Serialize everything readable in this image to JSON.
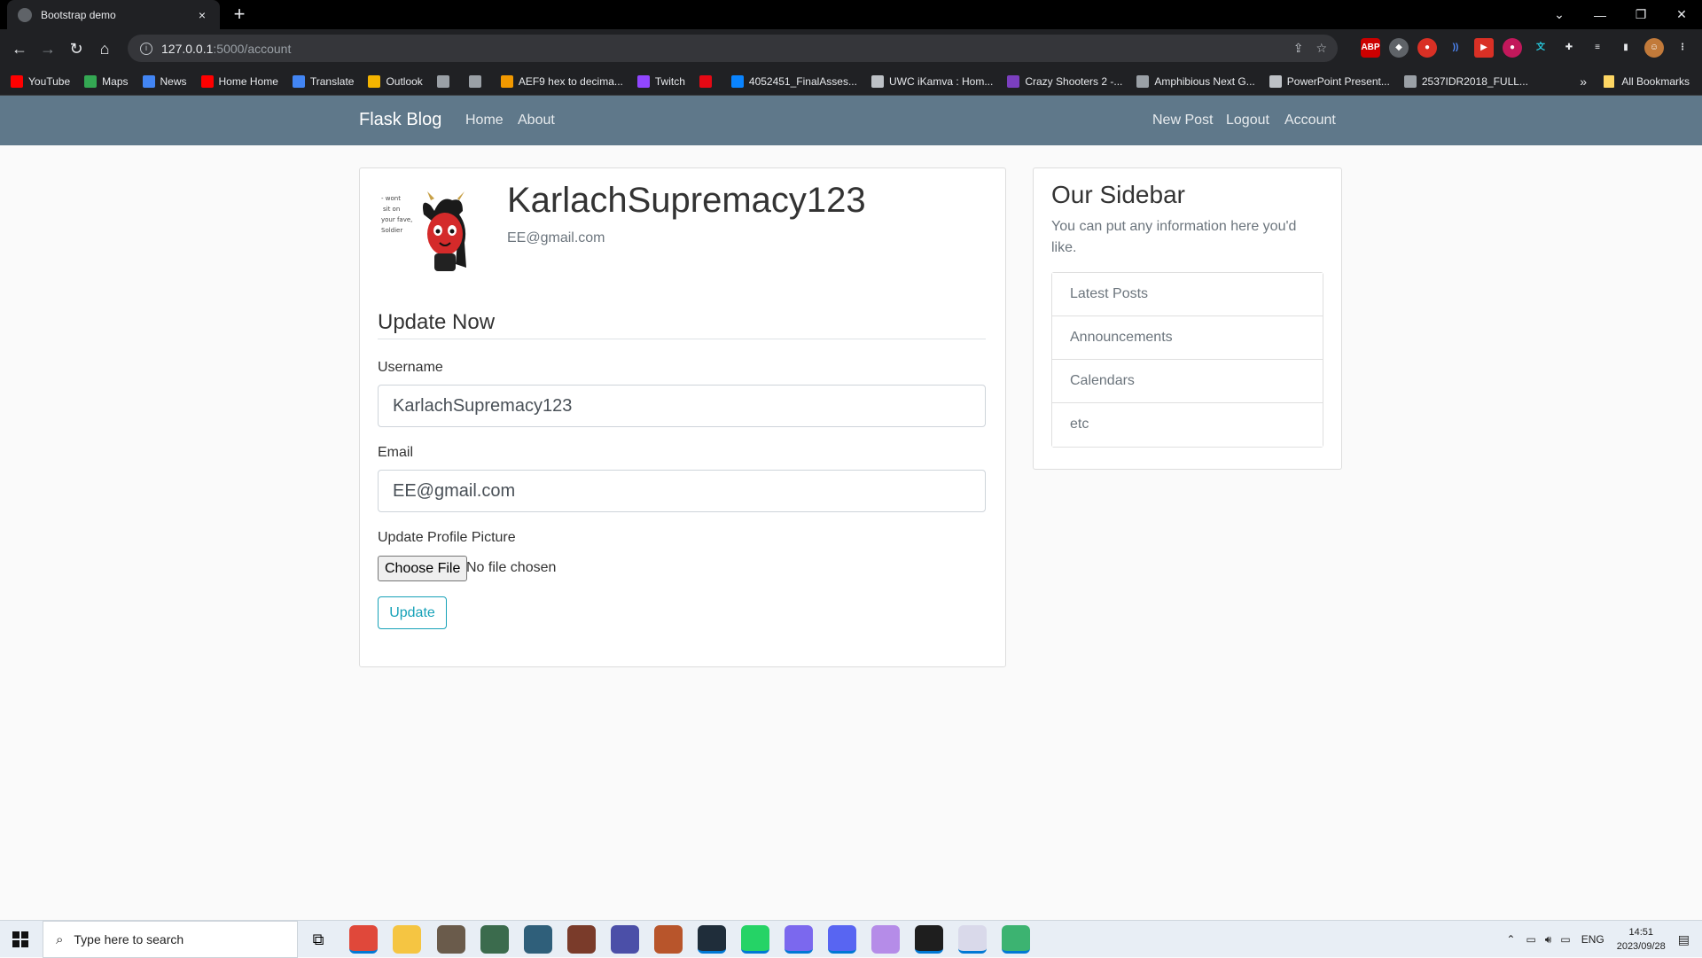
{
  "browser": {
    "tab_title": "Bootstrap demo",
    "tab_close": "×",
    "new_tab": "+",
    "url_host": "127.0.0.1",
    "url_path": ":5000/account",
    "bookmarks": [
      {
        "label": "YouTube",
        "icon": "youtube-icon",
        "color": "#ff0000"
      },
      {
        "label": "Maps",
        "icon": "maps-icon",
        "color": "#34a853"
      },
      {
        "label": "News",
        "icon": "news-icon",
        "color": "#4285f4"
      },
      {
        "label": "Home Home",
        "icon": "youtube-icon",
        "color": "#ff0000"
      },
      {
        "label": "Translate",
        "icon": "translate-icon",
        "color": "#4285f4"
      },
      {
        "label": "Outlook",
        "icon": "outlook-icon",
        "color": "#f4b400"
      },
      {
        "label": "",
        "icon": "globe-icon",
        "color": "#9aa0a6"
      },
      {
        "label": "",
        "icon": "globe-icon",
        "color": "#9aa0a6"
      },
      {
        "label": "AEF9 hex to decima...",
        "icon": "r-icon",
        "color": "#f29900"
      },
      {
        "label": "Twitch",
        "icon": "twitch-icon",
        "color": "#9146ff"
      },
      {
        "label": "",
        "icon": "netflix-icon",
        "color": "#e50914"
      },
      {
        "label": "4052451_FinalAsses...",
        "icon": "onedrive-icon",
        "color": "#0a84ff"
      },
      {
        "label": "UWC iKamva : Hom...",
        "icon": "uwc-icon",
        "color": "#bdc1c6"
      },
      {
        "label": "Crazy Shooters 2 -...",
        "icon": "crazy-icon",
        "color": "#7b3fbf"
      },
      {
        "label": "Amphibious Next G...",
        "icon": "globe-icon",
        "color": "#9aa0a6"
      },
      {
        "label": "PowerPoint Present...",
        "icon": "uwc-icon",
        "color": "#bdc1c6"
      },
      {
        "label": "2537IDR2018_FULL...",
        "icon": "globe-icon",
        "color": "#9aa0a6"
      }
    ],
    "bookmarks_more": "»",
    "all_bookmarks": "All Bookmarks"
  },
  "site": {
    "brand": "Flask Blog",
    "nav_left": [
      "Home",
      "About"
    ],
    "nav_right": [
      "New Post",
      "Logout",
      "Account"
    ],
    "navbar_color": "#5f788a"
  },
  "account": {
    "username": "KarlachSupremacy123",
    "email": "EE@gmail.com",
    "avatar_caption": "- wont\nsit on\nyour fave,\nSoldier",
    "legend": "Update Now",
    "username_label": "Username",
    "username_value": "KarlachSupremacy123",
    "email_label": "Email",
    "email_value": "EE@gmail.com",
    "picture_label": "Update Profile Picture",
    "choose_file": "Choose File",
    "file_status": "No file chosen",
    "submit": "Update",
    "accent": "#17a2b8"
  },
  "sidebar": {
    "title": "Our Sidebar",
    "text": "You can put any information here you'd like.",
    "items": [
      "Latest Posts",
      "Announcements",
      "Calendars",
      "etc"
    ]
  },
  "taskbar": {
    "search_placeholder": "Type here to search",
    "language": "ENG",
    "time": "14:51",
    "date": "2023/09/28"
  }
}
